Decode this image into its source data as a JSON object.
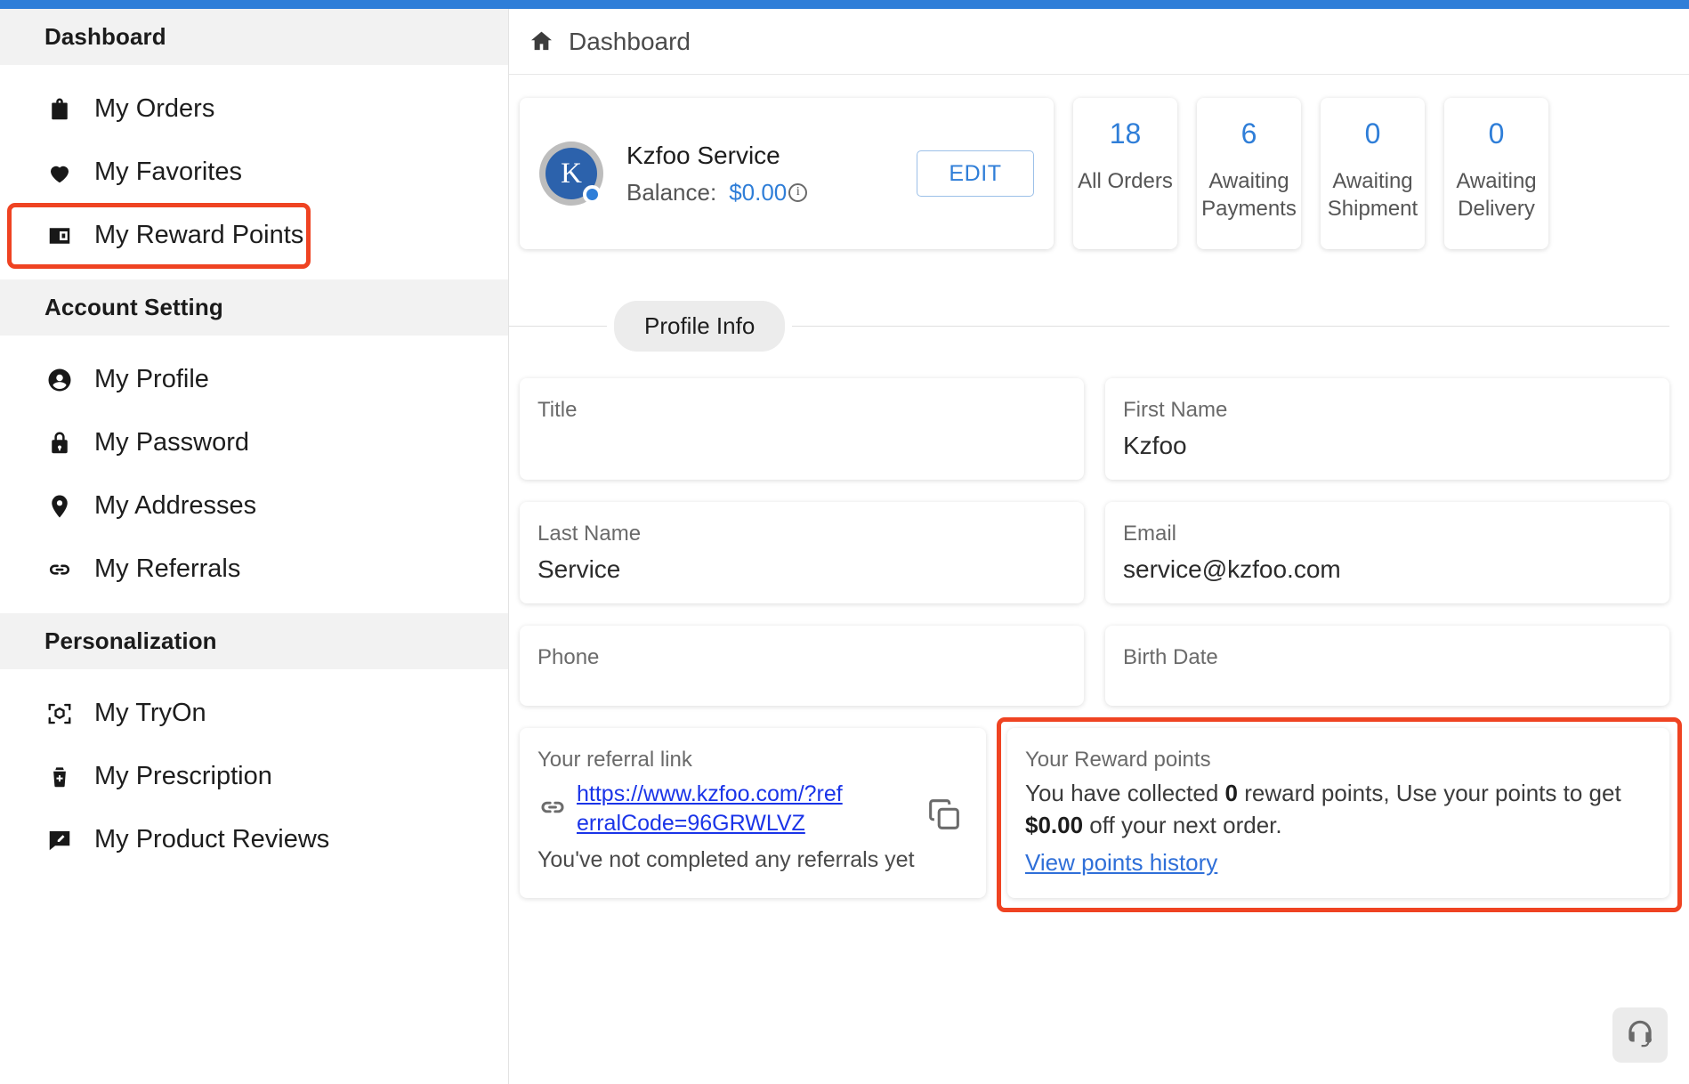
{
  "topbar": {
    "color": "#2f7ed8"
  },
  "sidebar": {
    "sections": [
      {
        "title": "Dashboard",
        "items": [
          {
            "label": "My Orders",
            "icon": "bag-icon",
            "highlighted": false
          },
          {
            "label": "My Favorites",
            "icon": "heart-icon",
            "highlighted": false
          },
          {
            "label": "My Reward Points",
            "icon": "wallet-icon",
            "highlighted": true
          }
        ]
      },
      {
        "title": "Account Setting",
        "items": [
          {
            "label": "My Profile",
            "icon": "person-icon",
            "highlighted": false
          },
          {
            "label": "My Password",
            "icon": "lock-icon",
            "highlighted": false
          },
          {
            "label": "My Addresses",
            "icon": "location-pin-icon",
            "highlighted": false
          },
          {
            "label": "My Referrals",
            "icon": "link-icon",
            "highlighted": false
          }
        ]
      },
      {
        "title": "Personalization",
        "items": [
          {
            "label": "My TryOn",
            "icon": "cube-scan-icon",
            "highlighted": false
          },
          {
            "label": "My Prescription",
            "icon": "prescription-icon",
            "highlighted": false
          },
          {
            "label": "My Product Reviews",
            "icon": "review-icon",
            "highlighted": false
          }
        ]
      }
    ]
  },
  "breadcrumb": {
    "icon": "home-icon",
    "label": "Dashboard"
  },
  "profile_card": {
    "avatar_letter": "K",
    "name": "Kzfoo Service",
    "balance_label": "Balance:",
    "balance_value": "$0.00",
    "info_icon": "info-icon",
    "edit_label": "EDIT"
  },
  "stats": [
    {
      "value": "18",
      "caption": "All Orders"
    },
    {
      "value": "6",
      "caption": "Awaiting Payments"
    },
    {
      "value": "0",
      "caption": "Awaiting Shipment"
    },
    {
      "value": "0",
      "caption": "Awaiting Delivery"
    }
  ],
  "section_tab": {
    "label": "Profile Info"
  },
  "form": {
    "rows": [
      [
        {
          "label": "Title",
          "value": ""
        },
        {
          "label": "First Name",
          "value": "Kzfoo"
        }
      ],
      [
        {
          "label": "Last Name",
          "value": "Service"
        },
        {
          "label": "Email",
          "value": "service@kzfoo.com"
        }
      ],
      [
        {
          "label": "Phone",
          "value": ""
        },
        {
          "label": "Birth Date",
          "value": ""
        }
      ]
    ]
  },
  "referral_card": {
    "title": "Your referral link",
    "link_icon": "link-icon",
    "url": "https://www.kzfoo.com/?referralCode=96GRWLVZ",
    "note": "You've not completed any referrals yet",
    "copy_icon": "copy-icon"
  },
  "reward_card": {
    "title": "Your Reward points",
    "text_before_points": "You have collected ",
    "points": "0",
    "text_middle": " reward points, Use your points to get ",
    "amount": "$0.00",
    "text_after": " off your next order.",
    "link_label": "View points history",
    "highlight_color": "#ef4322"
  },
  "support_button": {
    "icon": "headset-icon"
  }
}
